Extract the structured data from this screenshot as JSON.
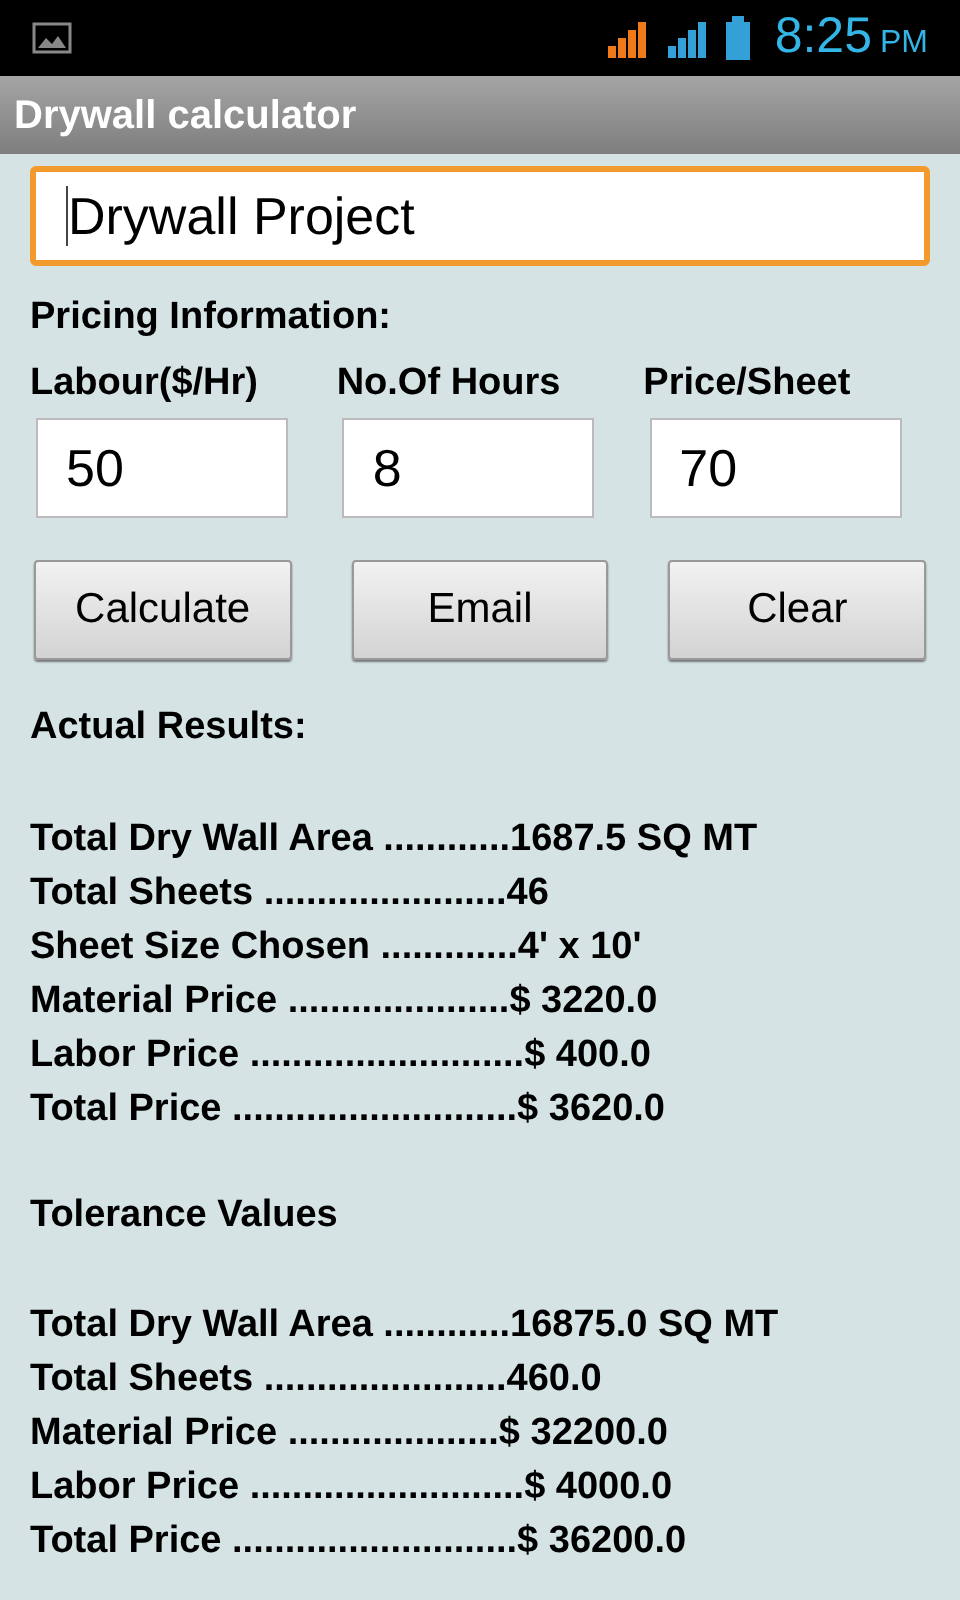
{
  "status_bar": {
    "time": "8:25",
    "meridiem": "PM"
  },
  "title_bar": {
    "title": "Drywall calculator"
  },
  "project_field": {
    "value": "Drywall Project",
    "focused": true
  },
  "pricing": {
    "heading": "Pricing Information:",
    "fields": [
      {
        "label": "Labour($/Hr)",
        "value": "50"
      },
      {
        "label": "No.Of Hours",
        "value": "8"
      },
      {
        "label": "Price/Sheet",
        "value": "70"
      }
    ]
  },
  "buttons": [
    "Calculate",
    "Email",
    "Clear"
  ],
  "actual_results": {
    "heading": "Actual Results:",
    "lines": [
      "Total Dry Wall Area ............1687.5 SQ MT",
      "Total Sheets .......................46",
      "Sheet Size Chosen .............4' x 10'",
      "Material Price .....................$ 3220.0",
      "Labor Price ..........................$ 400.0",
      "Total Price ...........................$ 3620.0"
    ]
  },
  "tolerance_values": {
    "heading": "Tolerance Values",
    "lines": [
      "Total Dry Wall Area ............16875.0 SQ MT",
      "Total Sheets .......................460.0",
      "Material Price ....................$ 32200.0",
      "Labor Price ..........................$ 4000.0",
      "Total Price ...........................$ 36200.0"
    ]
  }
}
